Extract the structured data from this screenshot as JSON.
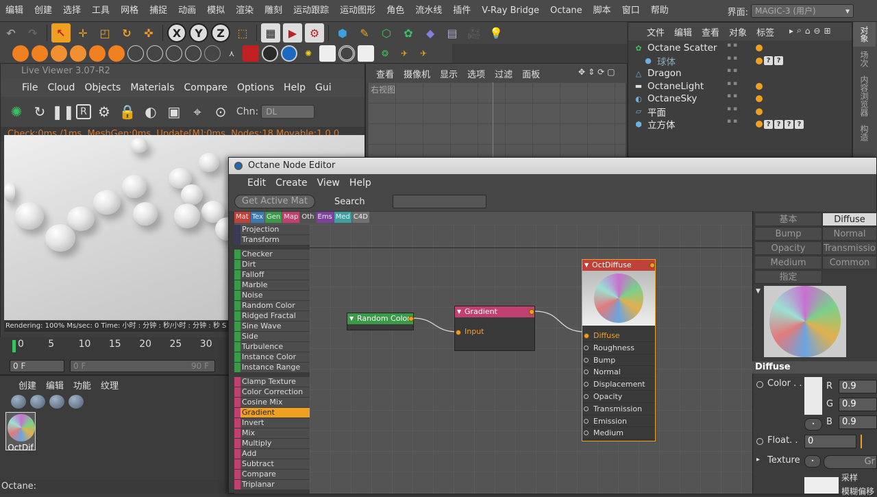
{
  "menubar": {
    "items": [
      "编辑",
      "创建",
      "选择",
      "工具",
      "网格",
      "捕捉",
      "动画",
      "模拟",
      "渲染",
      "雕刻",
      "运动跟踪",
      "运动图形",
      "角色",
      "流水线",
      "插件",
      "V-Ray Bridge",
      "Octane",
      "脚本",
      "窗口",
      "帮助"
    ],
    "layout_label": "界面:",
    "layout_value": "MAGIC-3 (用户)"
  },
  "live_viewer": {
    "title": "Live Viewer 3.07-R2",
    "menu": [
      "File",
      "Cloud",
      "Objects",
      "Materials",
      "Compare",
      "Options",
      "Help",
      "Gui"
    ],
    "chn_label": "Chn:",
    "chn_value": "DL",
    "status": "Check:0ms./1ms. MeshGen:0ms. Update[M]:0ms. Nodes:18 Movable:1  0 0",
    "render_info": "Rendering: 100%    Ms/sec: 0   Time: 小时 : 分钟 : 秒/小时 : 分钟 : 秒   S"
  },
  "timeline": {
    "ticks": [
      "0",
      "5",
      "10",
      "15",
      "20",
      "25",
      "30",
      "35"
    ],
    "frame_current": "0 F",
    "frame_start": "0 F",
    "frame_end": "90 F"
  },
  "material_manager": {
    "menu": [
      "创建",
      "编辑",
      "功能",
      "纹理"
    ],
    "material_name": "OctDif"
  },
  "statusbar": "Octane:",
  "viewport": {
    "menu": [
      "查看",
      "摄像机",
      "显示",
      "选项",
      "过滤",
      "面板"
    ],
    "label": "右视图"
  },
  "object_manager": {
    "menu": [
      "文件",
      "编辑",
      "查看",
      "对象",
      "标签"
    ],
    "objects": [
      {
        "name": "Octane Scatter",
        "icon": "scatter-icon"
      },
      {
        "name": "球体",
        "icon": "sphere-icon"
      },
      {
        "name": "Dragon",
        "icon": "dragon-icon"
      },
      {
        "name": "OctaneLight",
        "icon": "light-icon"
      },
      {
        "name": "OctaneSky",
        "icon": "sky-icon"
      },
      {
        "name": "平面",
        "icon": "plane-icon"
      },
      {
        "name": "立方体",
        "icon": "cube-icon"
      }
    ],
    "side_tabs": [
      "对象",
      "场次",
      "内容浏览器",
      "构造"
    ]
  },
  "node_editor": {
    "title": "Octane Node Editor",
    "menu": [
      "Edit",
      "Create",
      "View",
      "Help"
    ],
    "get_active_label": "Get Active Mat",
    "search_label": "Search",
    "categories": [
      {
        "label": "Mat",
        "color": "#c0403a"
      },
      {
        "label": "Tex",
        "color": "#3a7ab0"
      },
      {
        "label": "Gen",
        "color": "#3a9a48"
      },
      {
        "label": "Map",
        "color": "#c04070"
      },
      {
        "label": "Oth",
        "color": "#505050"
      },
      {
        "label": "Ems",
        "color": "#8040a0"
      },
      {
        "label": "Med",
        "color": "#40a0a0"
      },
      {
        "label": "C4D",
        "color": "#707070"
      }
    ],
    "list_group1": [
      "Projection",
      "Transform"
    ],
    "list_group2": [
      "Checker",
      "Dirt",
      "Falloff",
      "Marble",
      "Noise",
      "Random Color",
      "Ridged Fractal",
      "Sine Wave",
      "Side",
      "Turbulence",
      "Instance Color",
      "Instance Range"
    ],
    "list_group3": [
      "Clamp Texture",
      "Color Correction",
      "Cosine Mix",
      "Gradient",
      "Invert",
      "Mix",
      "Multiply",
      "Add",
      "Subtract",
      "Compare",
      "Triplanar"
    ],
    "selected_item": "Gradient",
    "node_random": "Random Color",
    "node_gradient": "Gradient",
    "gradient_input": "Input",
    "node_diffuse": "OctDiffuse",
    "diffuse_pins": [
      "Diffuse",
      "Roughness",
      "Bump",
      "Normal",
      "Displacement",
      "Opacity",
      "Transmission",
      "Emission",
      "Medium"
    ]
  },
  "material_props": {
    "tabs": [
      "基本",
      "Diffuse",
      "Bump",
      "Normal",
      "Opacity",
      "Transmissio",
      "Medium",
      "Common",
      "指定"
    ],
    "section": "Diffuse",
    "color_label": "Color . .",
    "r_label": "R",
    "r_value": "0.9",
    "g_label": "G",
    "g_value": "0.9",
    "b_label": "B",
    "b_value": "0.9",
    "float_label": "Float. .",
    "float_value": "0",
    "texture_label": "Texture",
    "texture_value": "Gr",
    "sampling_label": "采样",
    "blur_label": "模糊偏移"
  }
}
